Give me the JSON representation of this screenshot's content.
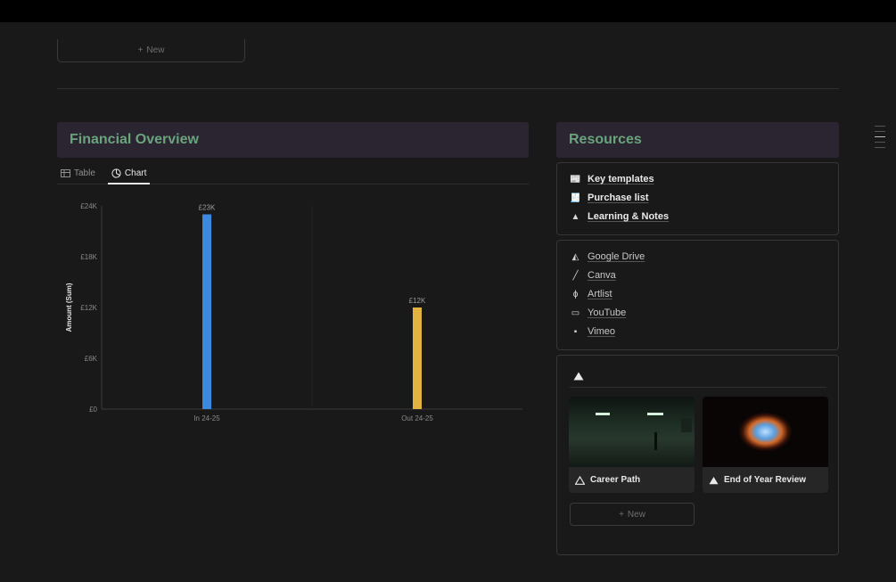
{
  "top_new_button": {
    "label": "New"
  },
  "financial": {
    "title": "Financial Overview",
    "tabs": [
      {
        "label": "Table",
        "icon": "table-icon"
      },
      {
        "label": "Chart",
        "icon": "chart-icon"
      }
    ]
  },
  "chart_data": {
    "type": "bar",
    "categories": [
      "In 24-25",
      "Out 24-25"
    ],
    "values": [
      23000,
      12000
    ],
    "data_labels": [
      "£23K",
      "£12K"
    ],
    "colors": [
      "#3b8ae0",
      "#e3b341"
    ],
    "ylabel": "Amount (Sum)",
    "xlabel": "",
    "ylim": [
      0,
      24000
    ],
    "yticks": [
      0,
      6000,
      12000,
      18000,
      24000
    ],
    "ytick_labels": [
      "£0",
      "£6K",
      "£12K",
      "£18K",
      "£24K"
    ],
    "grid": false
  },
  "resources": {
    "title": "Resources",
    "primary_links": [
      {
        "icon": "newspaper-icon",
        "glyph": "📰",
        "label": "Key templates"
      },
      {
        "icon": "receipt-icon",
        "glyph": "🧾",
        "label": "Purchase list"
      },
      {
        "icon": "triangle-icon",
        "glyph": "▲",
        "label": "Learning & Notes"
      }
    ],
    "tool_links": [
      {
        "icon": "google-drive-icon",
        "glyph": "◭",
        "label": "Google Drive"
      },
      {
        "icon": "pencil-icon",
        "glyph": "╱",
        "label": "Canva"
      },
      {
        "icon": "artlist-icon",
        "glyph": "ɸ",
        "label": "Artlist"
      },
      {
        "icon": "monitor-icon",
        "glyph": "▭",
        "label": "YouTube"
      },
      {
        "icon": "camera-icon",
        "glyph": "▪",
        "label": "Vimeo"
      }
    ],
    "gallery": {
      "cards": [
        {
          "label": "Career Path",
          "icon": "triangle-outline-icon"
        },
        {
          "label": "End of Year Review",
          "icon": "triangle-icon"
        }
      ],
      "new_label": "New"
    }
  }
}
